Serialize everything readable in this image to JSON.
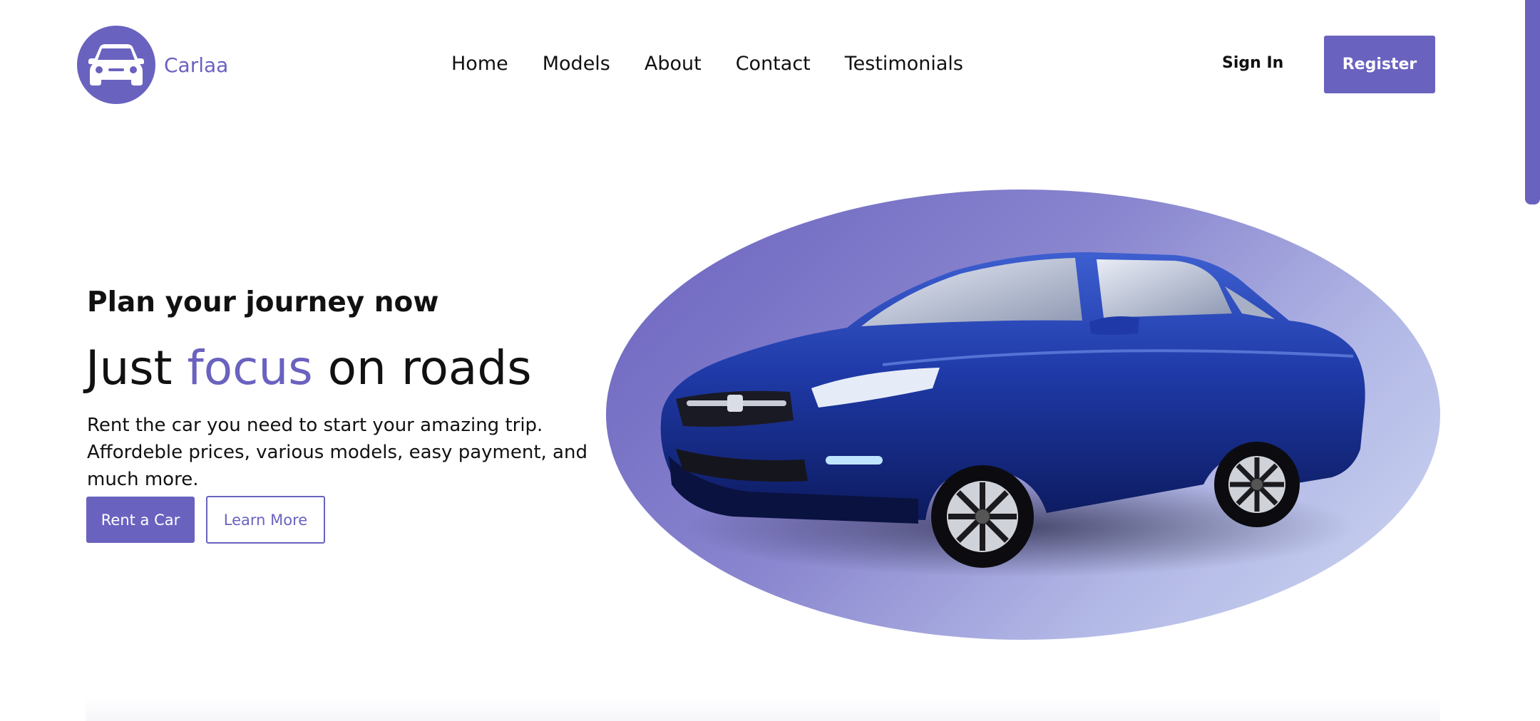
{
  "brand": {
    "name": "Carlaa",
    "logo_icon": "car-icon",
    "accent_color": "#6a62bf"
  },
  "nav": {
    "items": [
      {
        "label": "Home"
      },
      {
        "label": "Models"
      },
      {
        "label": "About"
      },
      {
        "label": "Contact"
      },
      {
        "label": "Testimonials"
      }
    ],
    "sign_in_label": "Sign In",
    "register_label": "Register"
  },
  "hero": {
    "subtitle": "Plan your journey now",
    "title_prefix": "Just ",
    "title_accent": "focus",
    "title_suffix": " on roads",
    "description": "Rent the car you need to start your amazing trip. Affordeble prices, various models, easy payment, and much more.",
    "rent_button_label": "Rent a Car",
    "learn_button_label": "Learn More",
    "image": "blue-sedan-car"
  }
}
